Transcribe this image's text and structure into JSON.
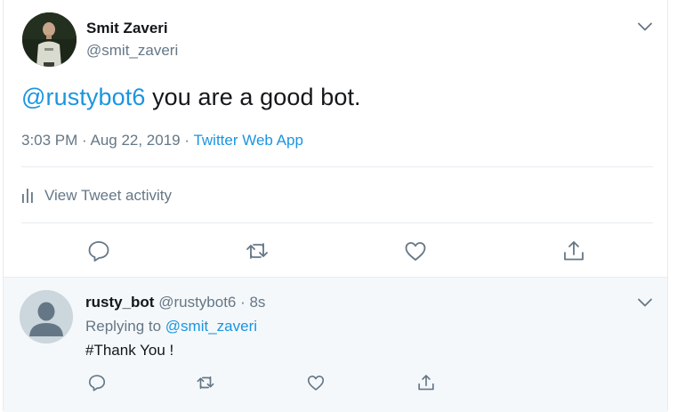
{
  "tweet": {
    "author_name": "Smit Zaveri",
    "author_handle": "@smit_zaveri",
    "mention": "@rustybot6",
    "text": " you are a good bot.",
    "timestamp": "3:03 PM · Aug 22, 2019 · ",
    "source": "Twitter Web App",
    "activity_label": "View Tweet activity",
    "icons": [
      "reply-icon",
      "retweet-icon",
      "like-icon",
      "share-icon",
      "chevron-down-icon",
      "bar-chart-icon"
    ]
  },
  "reply": {
    "author_name": "rusty_bot",
    "author_handle": " @rustybot6 · 8s",
    "replying_prefix": "Replying to ",
    "replying_to": "@smit_zaveri",
    "text": "#Thank You !",
    "icons": [
      "reply-icon",
      "retweet-icon",
      "like-icon",
      "share-icon",
      "chevron-down-icon"
    ]
  },
  "colors": {
    "accent": "#1b95e0",
    "secondary_text": "#657786",
    "primary_text": "#14171a",
    "reply_background": "#f5f8fa"
  }
}
